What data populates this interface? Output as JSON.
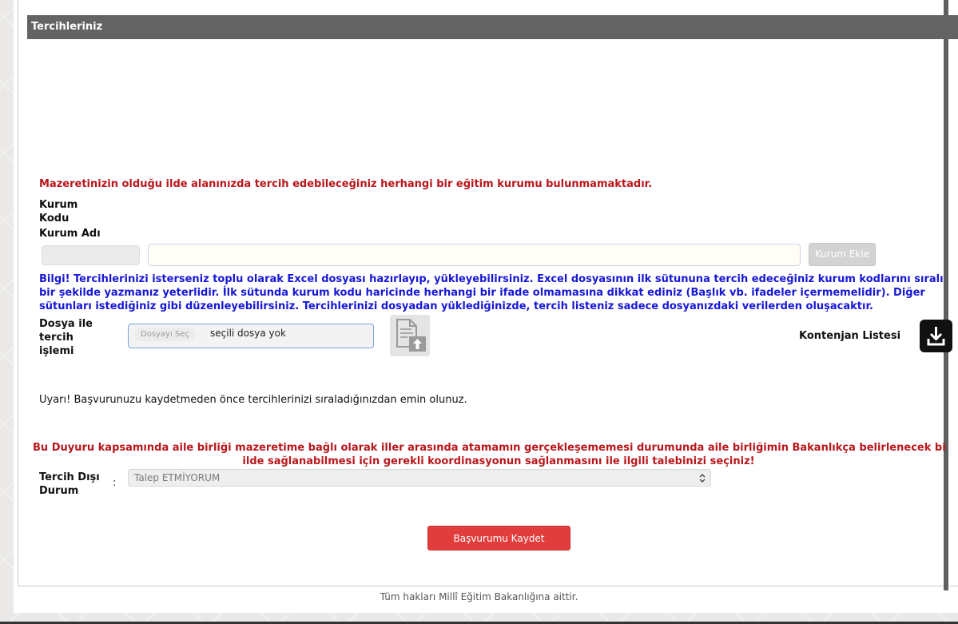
{
  "header": {
    "title": "Tercihleriniz"
  },
  "notice": {
    "no_institution": "Mazeretinizin olduğu ilde alanınızda tercih edebileceğiniz herhangi bir eğitim kurumu bulunmamaktadır."
  },
  "institution": {
    "code_label_line1": "Kurum",
    "code_label_line2": "Kodu",
    "name_label": "Kurum Adı",
    "code_value": "",
    "name_value": "",
    "add_button": "Kurum Ekle"
  },
  "info": {
    "line1": "Bilgi! Tercihlerinizi isterseniz toplu olarak Excel dosyası hazırlayıp, yükleyebilirsiniz. Excel dosyasının ilk sütununa tercih edeceğiniz kurum kodlarını sıralı",
    "line2": "bir şekilde yazmanız yeterlidir. İlk sütunda kurum kodu haricinde herhangi bir ifade olmamasına dikkat ediniz (Başlık vb. ifadeler içermemelidir). Diğer",
    "line3": "sütunları istediğiniz gibi düzenleyebilirsiniz. Tercihlerinizi dosyadan yüklediğinizde, tercih listeniz sadece dosyanızdaki verilerden oluşacaktır."
  },
  "file_upload": {
    "label_line1": "Dosya ile",
    "label_line2": "tercih",
    "label_line3": "işlemi",
    "choose_button": "Dosyayı Seç",
    "no_file_text": "seçili dosya yok",
    "upload_icon": "document-upload-icon"
  },
  "quota": {
    "label": "Kontenjan Listesi",
    "download_icon": "download-icon"
  },
  "warning": {
    "text": "Uyarı! Başvurunuzu kaydetmeden önce tercihlerinizi sıraladığınızdan emin olunuz."
  },
  "announcement": {
    "line1": "Bu Duyuru kapsamında aile birliği mazeretime bağlı olarak iller arasında atamamın gerçekleşememesi durumunda aile birliğimin Bakanlıkça belirlenecek bi",
    "line2": "ilde sağlanabilmesi için gerekli koordinasyonun sağlanmasını ile ilgili talebinizi seçiniz!"
  },
  "out_of_preference": {
    "label_line1": "Tercih Dışı",
    "label_line2": "Durum",
    "separator": ":",
    "selected": "Talep ETMİYORUM"
  },
  "actions": {
    "save_button": "Başvurumu Kaydet"
  },
  "footer": {
    "text": "Tüm hakları Millî Eğitim Bakanlığına aittir."
  },
  "colors": {
    "header_bg": "#636363",
    "warning_red": "#b8171c",
    "info_blue": "#1717d6",
    "save_button": "#e23d3d"
  }
}
